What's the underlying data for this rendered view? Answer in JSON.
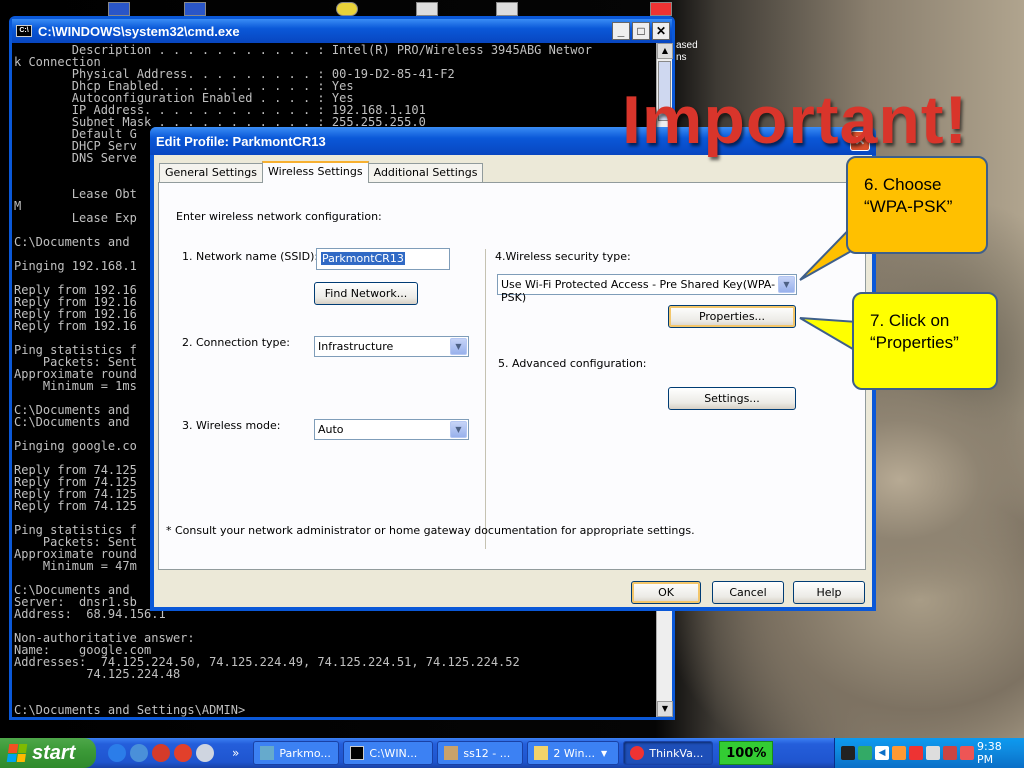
{
  "cmd": {
    "title": "C:\\WINDOWS\\system32\\cmd.exe",
    "lines": [
      "        Description . . . . . . . . . . . : Intel(R) PRO/Wireless 3945ABG Networ",
      "k Connection",
      "        Physical Address. . . . . . . . . : 00-19-D2-85-41-F2",
      "        Dhcp Enabled. . . . . . . . . . . : Yes",
      "        Autoconfiguration Enabled . . . . : Yes",
      "        IP Address. . . . . . . . . . . . : 192.168.1.101",
      "        Subnet Mask . . . . . . . . . . . : 255.255.255.0",
      "        Default G",
      "        DHCP Serv",
      "        DNS Serve",
      "",
      "",
      "        Lease Obt",
      "M",
      "        Lease Exp",
      "",
      "C:\\Documents and",
      "",
      "Pinging 192.168.1",
      "",
      "Reply from 192.16",
      "Reply from 192.16",
      "Reply from 192.16",
      "Reply from 192.16",
      "",
      "Ping statistics f",
      "    Packets: Sent",
      "Approximate round",
      "    Minimum = 1ms",
      "",
      "C:\\Documents and",
      "C:\\Documents and",
      "",
      "Pinging google.co",
      "",
      "Reply from 74.125",
      "Reply from 74.125",
      "Reply from 74.125",
      "Reply from 74.125",
      "",
      "Ping statistics f",
      "    Packets: Sent",
      "Approximate round",
      "    Minimum = 47m",
      "",
      "C:\\Documents and",
      "Server:  dnsr1.sb",
      "Address:  68.94.156.1",
      "",
      "Non-authoritative answer:",
      "Name:    google.com",
      "Addresses:  74.125.224.50, 74.125.224.49, 74.125.224.51, 74.125.224.52",
      "          74.125.224.48",
      "",
      "",
      "C:\\Documents and Settings\\ADMIN>"
    ]
  },
  "desktop": {
    "icon_text_1": "ased",
    "icon_text_2": "ns"
  },
  "dialog": {
    "title": "Edit Profile: ParkmontCR13",
    "tabs": [
      "General Settings",
      "Wireless Settings",
      "Additional Settings"
    ],
    "intro": "Enter wireless network configuration:",
    "ssid_label": "1. Network name (SSID):",
    "ssid_value": "ParkmontCR13",
    "find_network": "Find Network...",
    "connection_label": "2. Connection type:",
    "connection_value": "Infrastructure",
    "mode_label": "3. Wireless mode:",
    "mode_value": "Auto",
    "security_label": "4.Wireless security type:",
    "security_value": "Use Wi-Fi Protected Access - Pre Shared Key(WPA-PSK)",
    "properties": "Properties...",
    "advanced_label": "5. Advanced configuration:",
    "settings": "Settings...",
    "footnote": "* Consult your network administrator or home gateway documentation for appropriate settings.",
    "ok": "OK",
    "cancel": "Cancel",
    "help": "Help"
  },
  "annotations": {
    "important": "Important!",
    "callout6_line1": "6. Choose",
    "callout6_line2": "“WPA-PSK”",
    "callout7_line1": "7. Click on",
    "callout7_line2": "“Properties”"
  },
  "taskbar": {
    "start": "start",
    "tasks": [
      "Parkmo...",
      "C:\\WIN...",
      "ss12 - ...",
      "2 Win...",
      "ThinkVa..."
    ],
    "zoom": "100%",
    "clock": "9:38 PM",
    "show_more": "»"
  },
  "colors": {
    "callout6": "#ffc000",
    "callout7": "#ffff00",
    "important": "#d9352b"
  }
}
